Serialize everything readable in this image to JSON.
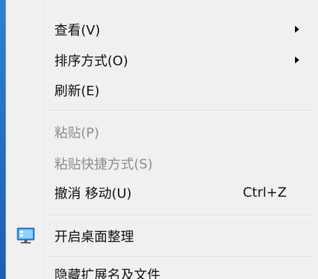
{
  "menu": {
    "items": [
      {
        "label": "查看(V)",
        "submenu": true,
        "enabled": true
      },
      {
        "label": "排序方式(O)",
        "submenu": true,
        "enabled": true
      },
      {
        "label": "刷新(E)",
        "enabled": true
      },
      {
        "label": "粘贴(P)",
        "enabled": false
      },
      {
        "label": "粘贴快捷方式(S)",
        "enabled": false
      },
      {
        "label": "撤消 移动(U)",
        "shortcut": "Ctrl+Z",
        "enabled": true
      },
      {
        "label": "开启桌面整理",
        "icon": "monitor-icon",
        "enabled": true
      },
      {
        "label": "隐藏扩展名及文件",
        "enabled": true
      }
    ]
  },
  "colors": {
    "menu_bg": "#f0f0f0",
    "desktop": "#2f7fd0",
    "disabled_text": "#8d8d8d",
    "icon_blue": "#2b8ddf"
  }
}
